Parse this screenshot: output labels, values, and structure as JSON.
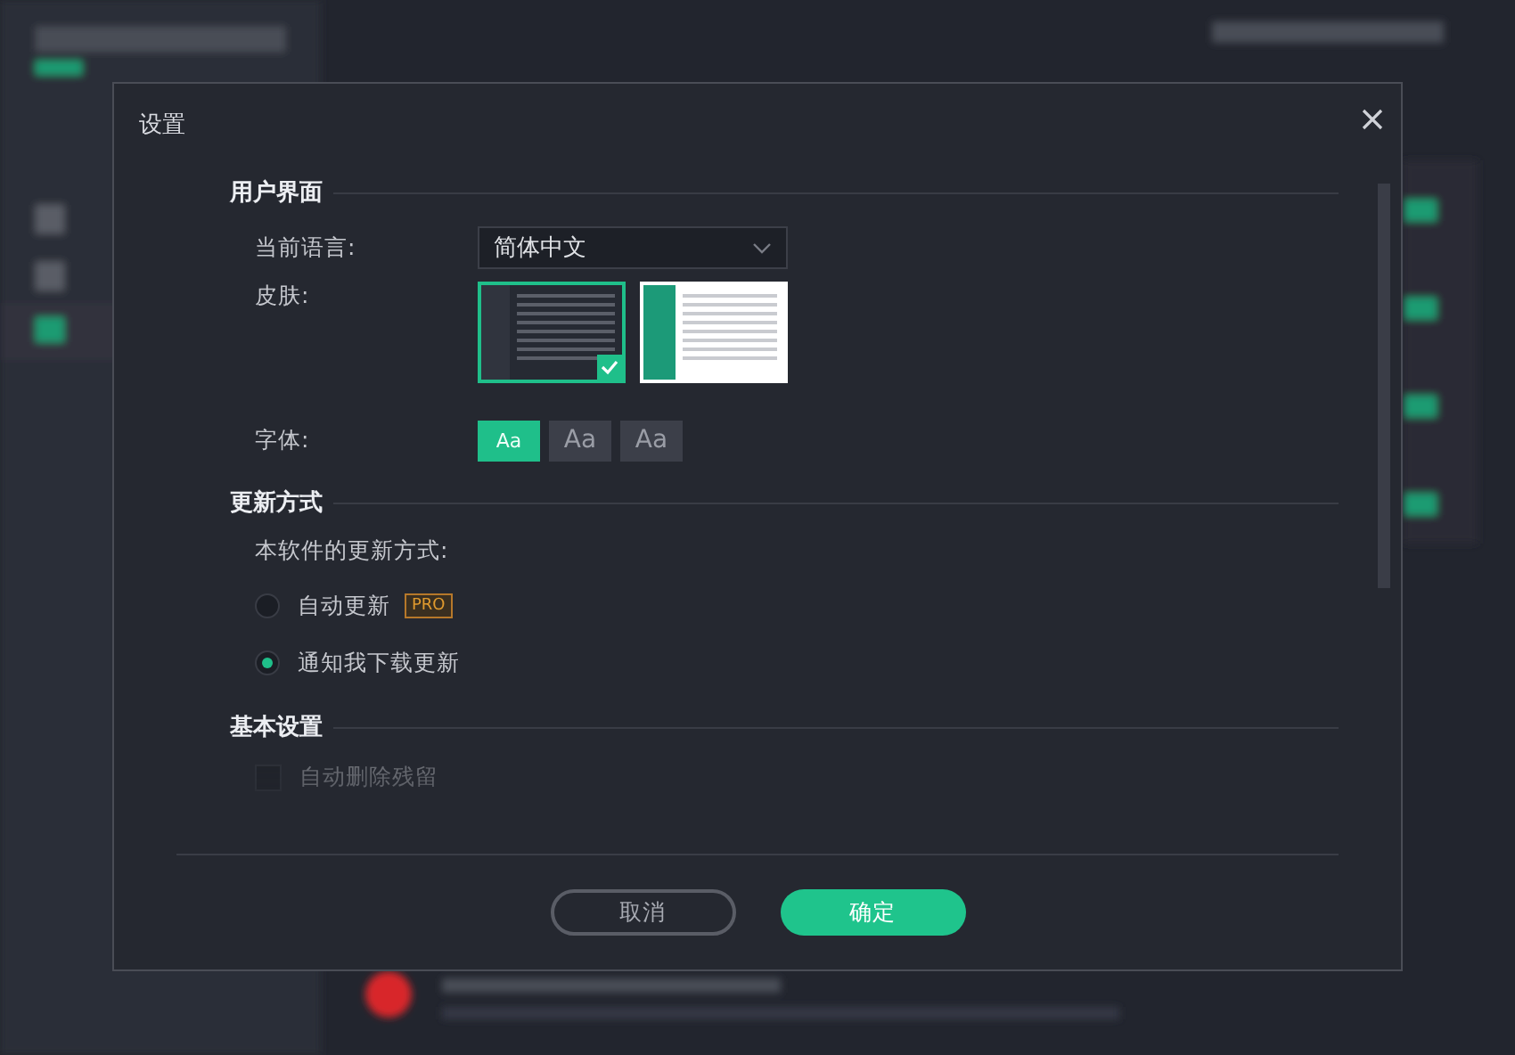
{
  "dialog": {
    "title": "设置"
  },
  "sections": [
    {
      "heading": "用户界面",
      "rows": [
        {
          "kind": "dropdown",
          "label": "当前语言:",
          "value": "简体中文"
        },
        {
          "kind": "skins",
          "label": "皮肤:",
          "skins": [
            {
              "kind": "dark",
              "selected": true
            },
            {
              "kind": "light",
              "selected": false
            }
          ]
        },
        {
          "kind": "fonts",
          "label": "字体:",
          "fonts": [
            {
              "kind": "small",
              "label": "Aa",
              "selected": true
            },
            {
              "kind": "large",
              "label": "Aa",
              "selected": false
            },
            {
              "kind": "large",
              "label": "Aa",
              "selected": false
            }
          ]
        }
      ]
    },
    {
      "heading": "更新方式",
      "rows": [
        {
          "kind": "text",
          "label": "本软件的更新方式:"
        },
        {
          "kind": "radio",
          "label": "自动更新",
          "badge": "PRO",
          "selected": false
        },
        {
          "kind": "radio",
          "label": "通知我下载更新",
          "selected": true
        }
      ]
    },
    {
      "heading": "基本设置",
      "rows": [
        {
          "kind": "checkbox",
          "label": "自动删除残留",
          "checked": false
        }
      ]
    }
  ],
  "buttons": [
    {
      "kind": "secondary",
      "label": "取消"
    },
    {
      "kind": "primary",
      "label": "确定"
    }
  ]
}
